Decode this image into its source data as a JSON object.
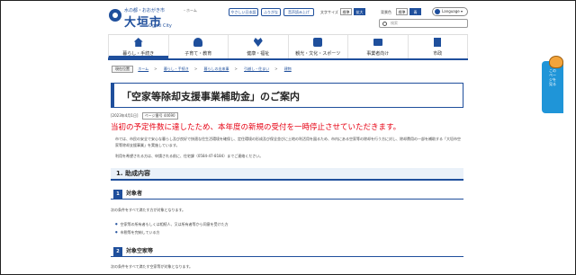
{
  "header": {
    "logo_tagline": "水の都・おおがき市",
    "logo_name": "大垣市",
    "logo_en": "Ogaki City",
    "home_link": "ホーム",
    "util_links": [
      "やさしい日本語",
      "ふりがな",
      "音声読み上げ"
    ],
    "font_size_label": "文字サイズ",
    "font_size_options": [
      "標準",
      "拡大"
    ],
    "contrast_label": "背景色",
    "contrast_options": [
      "標準",
      "青"
    ],
    "language_button": "Language",
    "search_placeholder": "検索"
  },
  "nav": {
    "items": [
      {
        "label": "暮らし・手続き",
        "icon": "home-icon"
      },
      {
        "label": "子育て・教育",
        "icon": "family-icon"
      },
      {
        "label": "健康・福祉",
        "icon": "care-icon"
      },
      {
        "label": "観光・文化・スポーツ",
        "icon": "camera-icon"
      },
      {
        "label": "事業者向け",
        "icon": "briefcase-icon"
      },
      {
        "label": "市政",
        "icon": "building-icon"
      }
    ]
  },
  "breadcrumb": {
    "current_marker": "現在位置",
    "items": [
      "ホーム",
      "暮らし・手続き",
      "暮らしの出来事",
      "引越し・住まい",
      "建物"
    ]
  },
  "page": {
    "title": "「空家等除却支援事業補助金」のご案内",
    "date": "[2023年4月1日]",
    "page_id": "ページ番号 44690",
    "notice": "当初の予定件数に達したため、本年度の新規の受付を一時停止させていただきます。",
    "intro": "市では、市民の安全で安心な暮らし及び良好で快適な住生活環境を確保し、定住環境の形成及び保全並びに土地の利活用を図るため、市内にある空家等の除却を行う方に対し、除却費用の一部を補助する「大垣市空家等除却支援事業」を実施しています。",
    "apply_note": "利用を希望される方は、申請される前に、住宅課（0584-47-8184）までご連絡ください。",
    "section1_title": "1.  助成内容",
    "sub1_num": "1",
    "sub1_title": "対象者",
    "sub1_text": "次の条件をすべて満たす方が対象となります。",
    "sub1_bullets": [
      "空家等の所有者もしくは相続人、又は所有者等から同意を受けた方",
      "市税等を完納している方"
    ],
    "sub2_num": "2",
    "sub2_title": "対象空家等",
    "sub2_text": "次の条件をすべて満たす空家等が対象となります。"
  },
  "side": {
    "ribbon_text": "このページを見る"
  }
}
